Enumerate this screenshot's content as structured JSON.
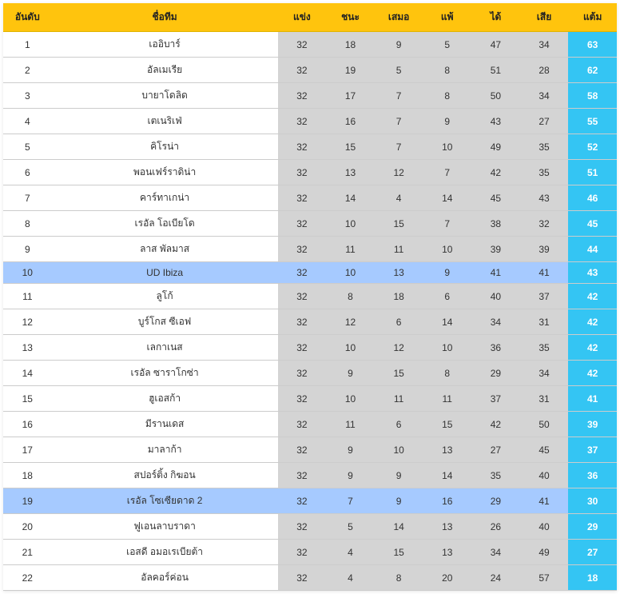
{
  "headers": {
    "rank": "อันดับ",
    "team": "ชื่อทีม",
    "played": "แข่ง",
    "won": "ชนะ",
    "drawn": "เสมอ",
    "lost": "แพ้",
    "gf": "ได้",
    "ga": "เสีย",
    "points": "แต้ม"
  },
  "rows": [
    {
      "rank": "1",
      "team": "เออิบาร์",
      "p": "32",
      "w": "18",
      "d": "9",
      "l": "5",
      "gf": "47",
      "ga": "34",
      "pts": "63",
      "hl": false
    },
    {
      "rank": "2",
      "team": "อัลเมเรีย",
      "p": "32",
      "w": "19",
      "d": "5",
      "l": "8",
      "gf": "51",
      "ga": "28",
      "pts": "62",
      "hl": false
    },
    {
      "rank": "3",
      "team": "บายาโดลิด",
      "p": "32",
      "w": "17",
      "d": "7",
      "l": "8",
      "gf": "50",
      "ga": "34",
      "pts": "58",
      "hl": false
    },
    {
      "rank": "4",
      "team": "เตเนริเฟ่",
      "p": "32",
      "w": "16",
      "d": "7",
      "l": "9",
      "gf": "43",
      "ga": "27",
      "pts": "55",
      "hl": false
    },
    {
      "rank": "5",
      "team": "คิโรน่า",
      "p": "32",
      "w": "15",
      "d": "7",
      "l": "10",
      "gf": "49",
      "ga": "35",
      "pts": "52",
      "hl": false
    },
    {
      "rank": "6",
      "team": "พอนเฟร์ราดิน่า",
      "p": "32",
      "w": "13",
      "d": "12",
      "l": "7",
      "gf": "42",
      "ga": "35",
      "pts": "51",
      "hl": false
    },
    {
      "rank": "7",
      "team": "คาร์ทาเกน่า",
      "p": "32",
      "w": "14",
      "d": "4",
      "l": "14",
      "gf": "45",
      "ga": "43",
      "pts": "46",
      "hl": false
    },
    {
      "rank": "8",
      "team": "เรอัล โอเบียโด",
      "p": "32",
      "w": "10",
      "d": "15",
      "l": "7",
      "gf": "38",
      "ga": "32",
      "pts": "45",
      "hl": false
    },
    {
      "rank": "9",
      "team": "ลาส พัลมาส",
      "p": "32",
      "w": "11",
      "d": "11",
      "l": "10",
      "gf": "39",
      "ga": "39",
      "pts": "44",
      "hl": false
    },
    {
      "rank": "10",
      "team": "UD Ibiza",
      "p": "32",
      "w": "10",
      "d": "13",
      "l": "9",
      "gf": "41",
      "ga": "41",
      "pts": "43",
      "hl": true
    },
    {
      "rank": "11",
      "team": "ลูโก้",
      "p": "32",
      "w": "8",
      "d": "18",
      "l": "6",
      "gf": "40",
      "ga": "37",
      "pts": "42",
      "hl": false
    },
    {
      "rank": "12",
      "team": "บูร์โกส ซีเอฟ",
      "p": "32",
      "w": "12",
      "d": "6",
      "l": "14",
      "gf": "34",
      "ga": "31",
      "pts": "42",
      "hl": false
    },
    {
      "rank": "13",
      "team": "เลกาเนส",
      "p": "32",
      "w": "10",
      "d": "12",
      "l": "10",
      "gf": "36",
      "ga": "35",
      "pts": "42",
      "hl": false
    },
    {
      "rank": "14",
      "team": "เรอัล ซาราโกซ่า",
      "p": "32",
      "w": "9",
      "d": "15",
      "l": "8",
      "gf": "29",
      "ga": "34",
      "pts": "42",
      "hl": false
    },
    {
      "rank": "15",
      "team": "ฮูเอสก้า",
      "p": "32",
      "w": "10",
      "d": "11",
      "l": "11",
      "gf": "37",
      "ga": "31",
      "pts": "41",
      "hl": false
    },
    {
      "rank": "16",
      "team": "มีรานเดส",
      "p": "32",
      "w": "11",
      "d": "6",
      "l": "15",
      "gf": "42",
      "ga": "50",
      "pts": "39",
      "hl": false
    },
    {
      "rank": "17",
      "team": "มาลาก้า",
      "p": "32",
      "w": "9",
      "d": "10",
      "l": "13",
      "gf": "27",
      "ga": "45",
      "pts": "37",
      "hl": false
    },
    {
      "rank": "18",
      "team": "สปอร์ติ้ง กิฆอน",
      "p": "32",
      "w": "9",
      "d": "9",
      "l": "14",
      "gf": "35",
      "ga": "40",
      "pts": "36",
      "hl": false
    },
    {
      "rank": "19",
      "team": "เรอัล โซเซียดาด 2",
      "p": "32",
      "w": "7",
      "d": "9",
      "l": "16",
      "gf": "29",
      "ga": "41",
      "pts": "30",
      "hl": true
    },
    {
      "rank": "20",
      "team": "ฟูเอนลาบราดา",
      "p": "32",
      "w": "5",
      "d": "14",
      "l": "13",
      "gf": "26",
      "ga": "40",
      "pts": "29",
      "hl": false
    },
    {
      "rank": "21",
      "team": "เอสดี อมอเรเบียต้า",
      "p": "32",
      "w": "4",
      "d": "15",
      "l": "13",
      "gf": "34",
      "ga": "49",
      "pts": "27",
      "hl": false
    },
    {
      "rank": "22",
      "team": "อัลคอร์ค่อน",
      "p": "32",
      "w": "4",
      "d": "8",
      "l": "20",
      "gf": "24",
      "ga": "57",
      "pts": "18",
      "hl": false
    }
  ]
}
